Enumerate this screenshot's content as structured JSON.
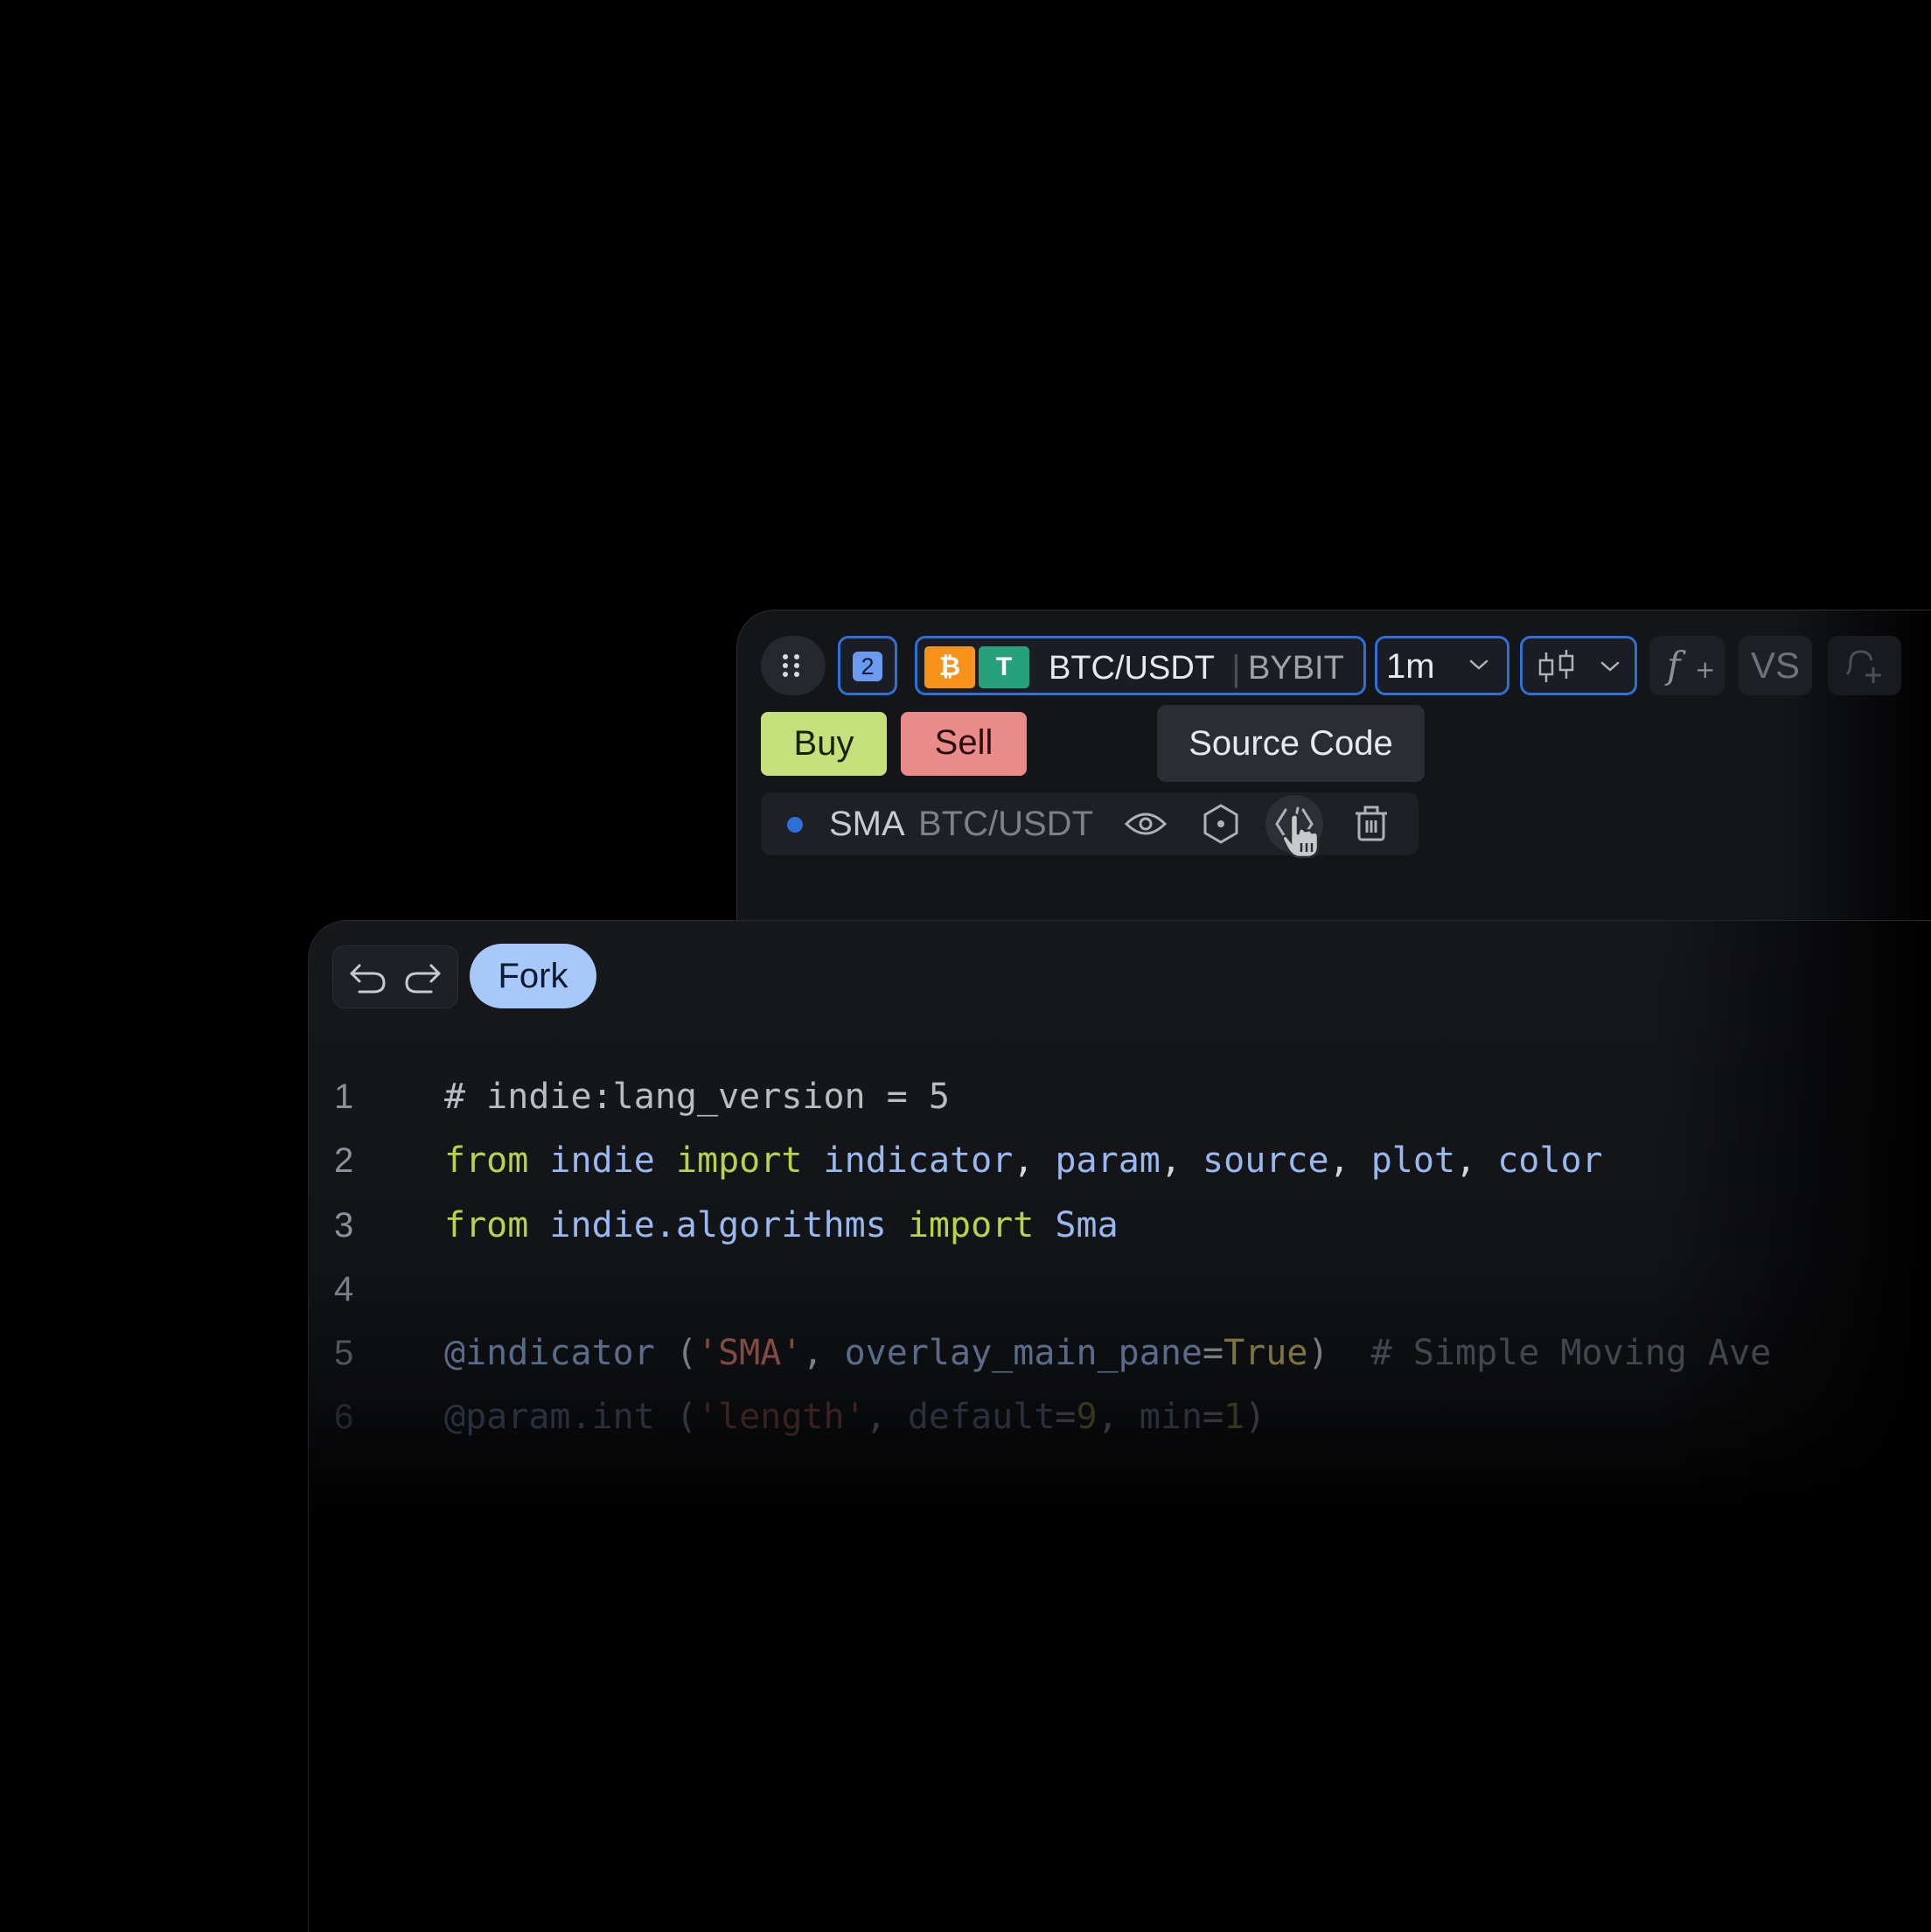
{
  "toolbar": {
    "layout_number": "2",
    "symbol": {
      "base_icon": "bitcoin-icon",
      "quote_icon": "tether-icon",
      "pair": "BTC/USDT",
      "separator": "|",
      "exchange": "BYBIT"
    },
    "timeframe": "1m",
    "chart_type_icon": "candlestick-icon",
    "indicators_icon": "function-plus-icon",
    "compare_label": "VS",
    "alert_icon": "add-alert-icon"
  },
  "trade": {
    "buy_label": "Buy",
    "sell_label": "Sell"
  },
  "tooltip": {
    "text": "Source Code"
  },
  "legend": {
    "name": "SMA",
    "symbol": "BTC/USDT",
    "color": "#2f6fd6",
    "actions": [
      "eye-icon",
      "settings-hexagon-icon",
      "source-code-icon",
      "trash-icon"
    ]
  },
  "editor": {
    "fork_label": "Fork",
    "lines": [
      {
        "num": "1",
        "tokens": [
          {
            "t": "# indie:lang_version = 5",
            "c": "c-com"
          }
        ]
      },
      {
        "num": "2",
        "tokens": [
          {
            "t": "from",
            "c": "c-kw"
          },
          {
            "t": " ",
            "c": "c-pl"
          },
          {
            "t": "indie",
            "c": "c-id"
          },
          {
            "t": " ",
            "c": "c-pl"
          },
          {
            "t": "import",
            "c": "c-kw"
          },
          {
            "t": " ",
            "c": "c-pl"
          },
          {
            "t": "indicator",
            "c": "c-id"
          },
          {
            "t": ", ",
            "c": "c-pl"
          },
          {
            "t": "param",
            "c": "c-id"
          },
          {
            "t": ", ",
            "c": "c-pl"
          },
          {
            "t": "source",
            "c": "c-id"
          },
          {
            "t": ", ",
            "c": "c-pl"
          },
          {
            "t": "plot",
            "c": "c-id"
          },
          {
            "t": ", ",
            "c": "c-pl"
          },
          {
            "t": "color",
            "c": "c-id"
          }
        ]
      },
      {
        "num": "3",
        "tokens": [
          {
            "t": "from",
            "c": "c-kw"
          },
          {
            "t": " ",
            "c": "c-pl"
          },
          {
            "t": "indie.algorithms",
            "c": "c-id"
          },
          {
            "t": " ",
            "c": "c-pl"
          },
          {
            "t": "import",
            "c": "c-kw"
          },
          {
            "t": " ",
            "c": "c-pl"
          },
          {
            "t": "Sma",
            "c": "c-id"
          }
        ]
      },
      {
        "num": "4",
        "tokens": []
      },
      {
        "num": "5",
        "tokens": [
          {
            "t": "@indicator",
            "c": "c-id"
          },
          {
            "t": " (",
            "c": "c-pl"
          },
          {
            "t": "'SMA'",
            "c": "c-str"
          },
          {
            "t": ", ",
            "c": "c-pl"
          },
          {
            "t": "overlay_main_pane",
            "c": "c-id"
          },
          {
            "t": "=",
            "c": "c-pl"
          },
          {
            "t": "True",
            "c": "c-bool"
          },
          {
            "t": ")  ",
            "c": "c-pl"
          },
          {
            "t": "# Simple Moving Ave",
            "c": "c-dim"
          }
        ]
      },
      {
        "num": "6",
        "tokens": [
          {
            "t": "@param.int",
            "c": "c-id"
          },
          {
            "t": " (",
            "c": "c-pl"
          },
          {
            "t": "'length'",
            "c": "c-str"
          },
          {
            "t": ", ",
            "c": "c-pl"
          },
          {
            "t": "default",
            "c": "c-id"
          },
          {
            "t": "=",
            "c": "c-pl"
          },
          {
            "t": "9",
            "c": "c-bool"
          },
          {
            "t": ", ",
            "c": "c-pl"
          },
          {
            "t": "min",
            "c": "c-id"
          },
          {
            "t": "=",
            "c": "c-pl"
          },
          {
            "t": "1",
            "c": "c-bool"
          },
          {
            "t": ")",
            "c": "c-pl"
          }
        ]
      }
    ]
  }
}
